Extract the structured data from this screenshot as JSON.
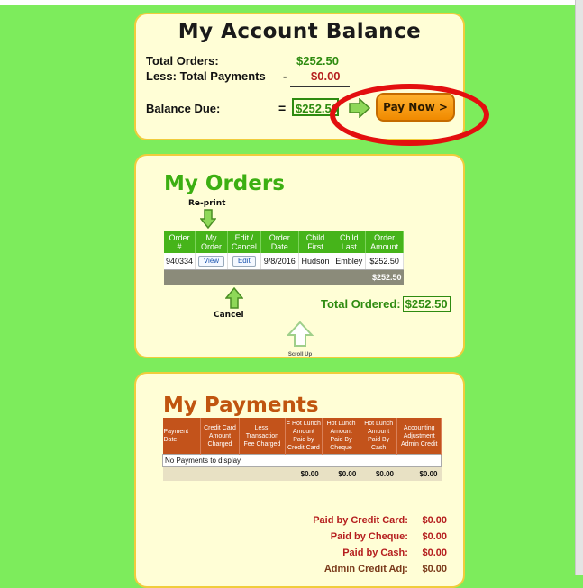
{
  "balance": {
    "title": "My Account Balance",
    "total_orders_label": "Total Orders:",
    "total_orders_value": "$252.50",
    "less_payments_label": "Less: Total Payments",
    "minus_sign": "-",
    "less_payments_value": "$0.00",
    "balance_due_label": "Balance Due:",
    "equals_sign": "=",
    "balance_due_value": "$252.50",
    "pay_now_label": "Pay Now >"
  },
  "orders": {
    "title": "My Orders",
    "reprint_label": "Re-print",
    "cancel_label": "Cancel",
    "columns": [
      "Order #",
      "My Order",
      "Edit / Cancel",
      "Order Date",
      "Child First",
      "Child Last",
      "Order Amount"
    ],
    "rows": [
      {
        "order_no": "940334",
        "view_label": "View",
        "edit_label": "Edit",
        "date": "9/8/2016",
        "child_first": "Hudson",
        "child_last": "Embley",
        "amount": "$252.50"
      }
    ],
    "subtotal": "$252.50",
    "total_ordered_label": "Total Ordered:",
    "total_ordered_value": "$252.50",
    "scroll_up_label": "Scroll Up"
  },
  "payments": {
    "title": "My Payments",
    "columns": [
      "Payment Date",
      "Credit Card Amount Charged",
      "Less: Transaction Fee Charged",
      "= Hot Lunch Amount Paid by Credit Card",
      "Hot Lunch Amount Paid By Cheque",
      "Hot Lunch Amount Paid By Cash",
      "Accounting Adjustment Admin Credit"
    ],
    "empty_message": "No Payments to display",
    "sums": [
      "$0.00",
      "$0.00",
      "$0.00",
      "$0.00"
    ],
    "totals": [
      {
        "label": "Paid by Credit Card:",
        "value": "$0.00"
      },
      {
        "label": "Paid by Cheque:",
        "value": "$0.00"
      },
      {
        "label": "Paid by Cash:",
        "value": "$0.00"
      },
      {
        "label": "Admin Credit Adj:",
        "value": "$0.00"
      }
    ]
  },
  "colors": {
    "background": "#7dec5c",
    "card": "#fffed6",
    "orders_accent": "#46b41a",
    "payments_accent": "#c3531b",
    "highlight_circle": "#e30f0f"
  },
  "icons": [
    "arrow-right-icon",
    "arrow-down-icon",
    "arrow-up-icon",
    "scroll-up-icon"
  ]
}
